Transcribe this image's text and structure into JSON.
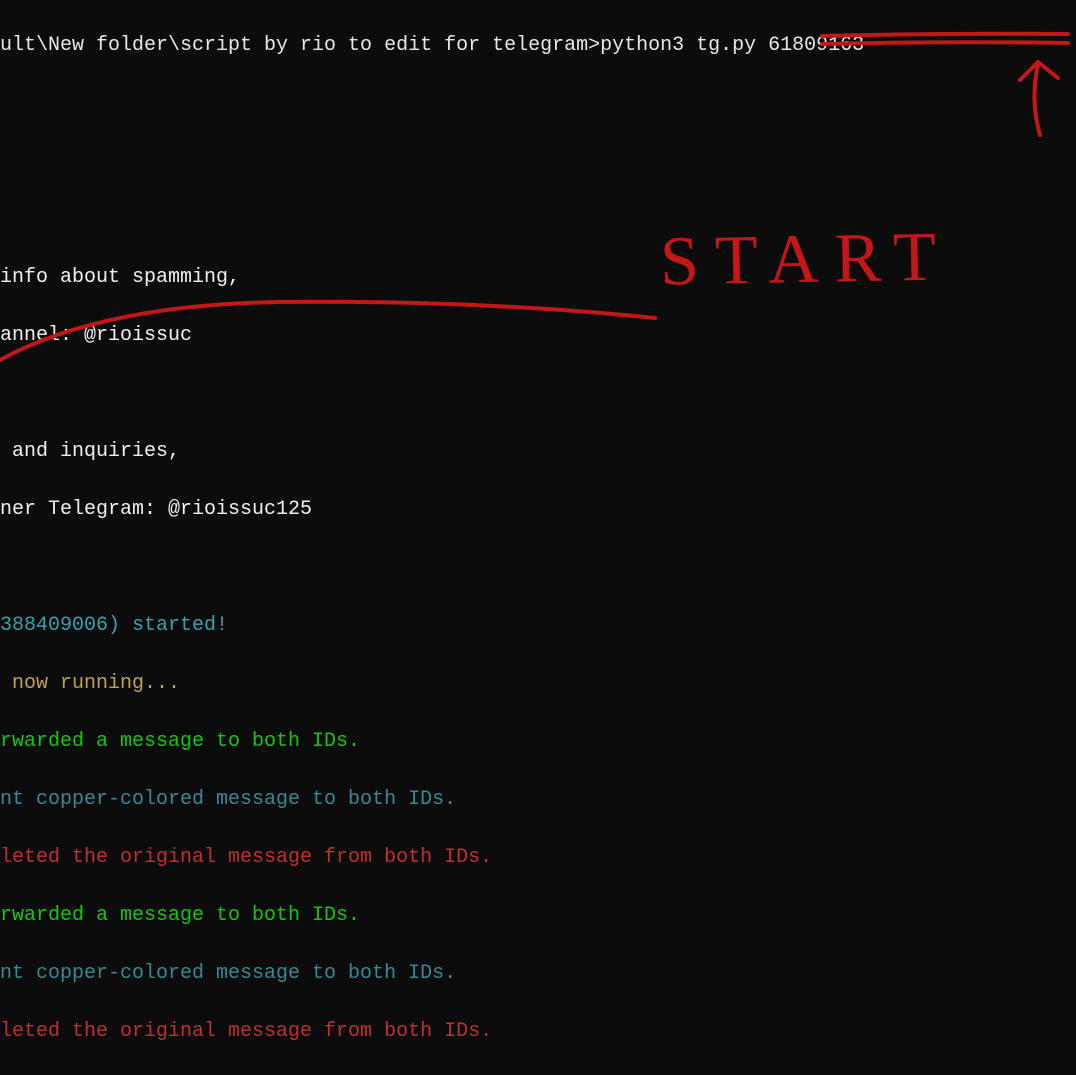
{
  "terminal": {
    "prompt_path": "ult\\New folder\\script by rio to edit for telegram>",
    "command": "python3 tg.py 61809163",
    "blank1": " ",
    "blank2": " ",
    "blank3": " ",
    "info_line1": "info about spamming,",
    "info_line2": "annel: @rioissuc",
    "blank4": " ",
    "inquiry_line1": " and inquiries,",
    "inquiry_line2": "ner Telegram: @rioissuc125",
    "blank5": " ",
    "started_id": "388409006) started!",
    "running": " now running...",
    "fwd1": "rwarded a message to both IDs.",
    "sent1": "nt copper-colored message to both IDs.",
    "del1": "leted the original message from both IDs.",
    "fwd2": "rwarded a message to both IDs.",
    "sent2": "nt copper-colored message to both IDs.",
    "del2": "leted the original message from both IDs."
  },
  "annotations": {
    "start_label": "START",
    "color": "#c41818"
  }
}
